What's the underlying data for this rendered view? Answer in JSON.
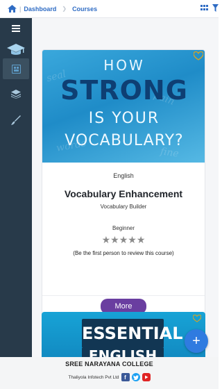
{
  "breadcrumb": {
    "separator": "|",
    "items": [
      "Dashboard",
      "Courses"
    ]
  },
  "courses": [
    {
      "image_lines": [
        "HOW",
        "STRONG",
        "IS YOUR",
        "VOCABULARY?"
      ],
      "language": "English",
      "title": "Vocabulary Enhancement",
      "subtitle": "Vocabulary Builder",
      "level": "Beginner",
      "stars": "★★★★★",
      "rating_value": 0,
      "review_note": "(Be the first person to review this course)",
      "action_label": "More"
    },
    {
      "image_lines": [
        "ESSENTIAL",
        "ENGLISH"
      ]
    }
  ],
  "fab_label": "+",
  "footer": {
    "college": "SREE NARAYANA COLLEGE",
    "company": "Thaliyola Infotech Pvt Ltd"
  },
  "colors": {
    "sidebar": "#283a4a",
    "accent_button": "#6a3ea0",
    "fab": "#2f7be0",
    "link": "#2f6cc4"
  }
}
